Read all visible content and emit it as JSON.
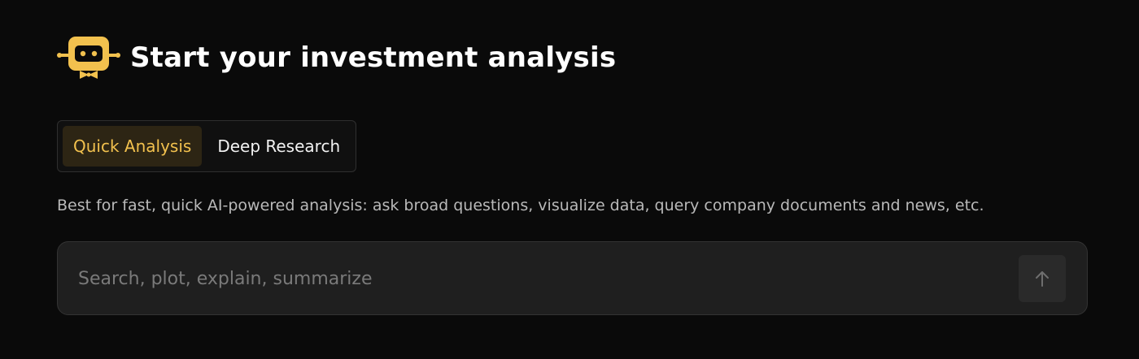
{
  "header": {
    "logo_icon": "robot-butler-icon",
    "title": "Start your investment analysis"
  },
  "tabs": [
    {
      "label": "Quick Analysis",
      "active": true
    },
    {
      "label": "Deep Research",
      "active": false
    }
  ],
  "description": "Best for fast, quick AI-powered analysis: ask broad questions, visualize data, query company documents and news, etc.",
  "search": {
    "value": "",
    "placeholder": "Search, plot, explain, summarize",
    "submit_icon": "arrow-up-icon"
  },
  "colors": {
    "background": "#0a0a0a",
    "accent": "#f2c14e",
    "active_tab_bg": "#2d2514",
    "input_bg": "#1f1f1f"
  }
}
